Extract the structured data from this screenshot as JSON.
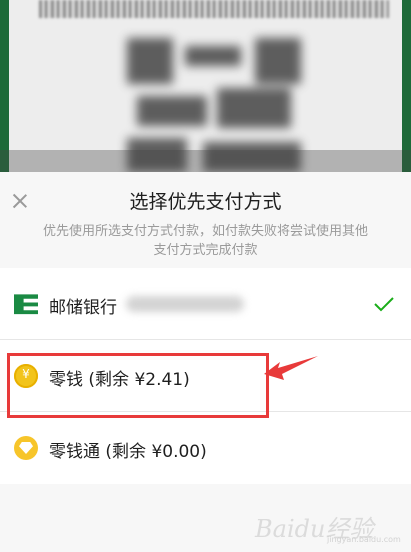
{
  "sheet": {
    "title": "选择优先支付方式",
    "subtitle": "优先使用所选支付方式付款，如付款失败将尝试使用其他支付方式完成付款",
    "close_icon": "close-icon"
  },
  "payment_methods": [
    {
      "label": "邮储银行",
      "icon": "bank-logo-icon",
      "selected": true
    },
    {
      "label": "零钱 (剩余 ¥2.41)",
      "icon": "coin-icon",
      "selected": false
    },
    {
      "label": "零钱通 (剩余 ¥0.00)",
      "icon": "diamond-icon",
      "selected": false
    }
  ],
  "colors": {
    "accent": "#1aad19",
    "annotation": "#e83a3a",
    "bank_green": "#1a8a43",
    "coin_yellow": "#f2c41b"
  },
  "watermark": {
    "logo": "Baidu经验",
    "url": "jingyan.baidu.com"
  }
}
